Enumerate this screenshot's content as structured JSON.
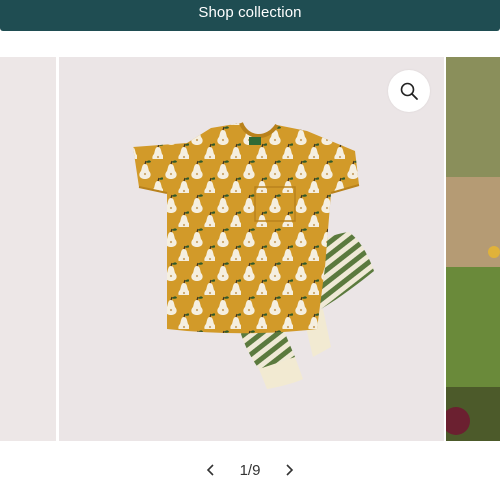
{
  "header": {
    "shop_label": "Shop collection"
  },
  "gallery": {
    "current_slide": 1,
    "total_slides": 9,
    "counter_text": "1/9"
  },
  "icons": {
    "zoom": "magnifier-icon",
    "prev": "chevron-left-icon",
    "next": "chevron-right-icon"
  },
  "colors": {
    "header_bg": "#1f4d52",
    "tshirt": "#d29a29",
    "stripe_green": "#5b7a3e",
    "cuff_cream": "#f2ead2",
    "slide_bg": "#ebe5e6"
  }
}
